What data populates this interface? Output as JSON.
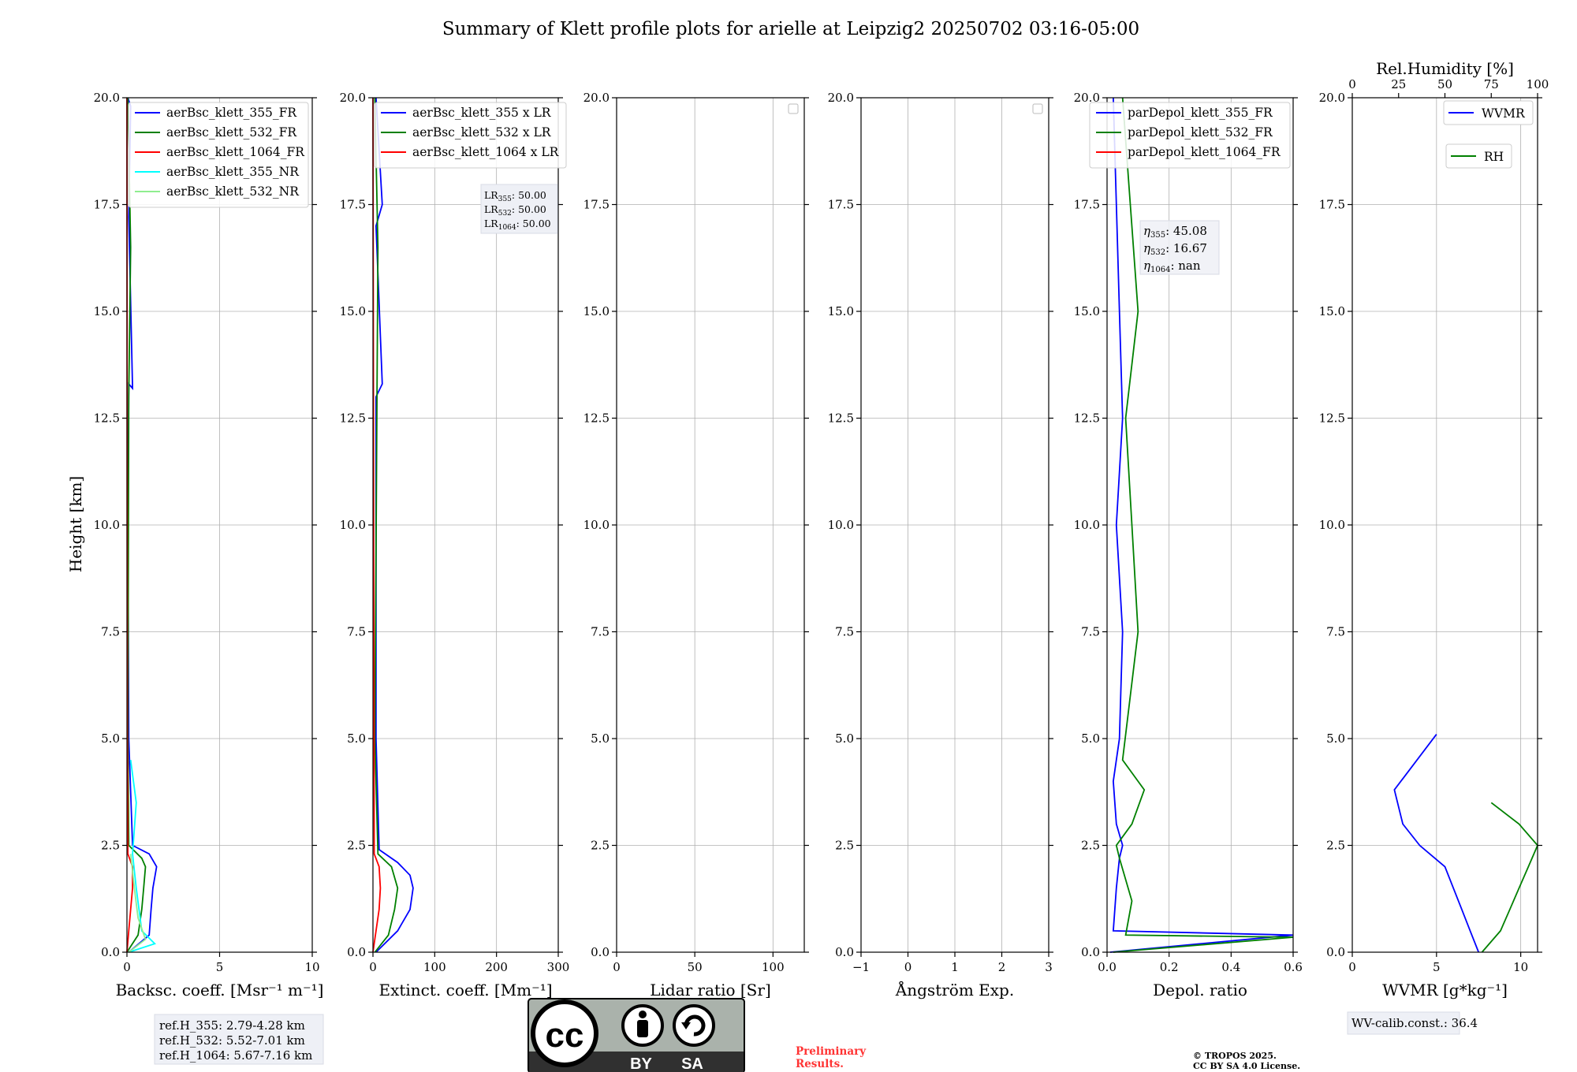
{
  "title": "Summary of Klett profile plots for arielle at Leipzig2 20250702 03:16-05:00",
  "y_axis_label": "Height [km]",
  "y_ticks": [
    "0.0",
    "2.5",
    "5.0",
    "7.5",
    "10.0",
    "12.5",
    "15.0",
    "17.5",
    "20.0"
  ],
  "colors": {
    "blue": "#0000ff",
    "green": "#008000",
    "red": "#ff0000",
    "cyan": "#00ffff",
    "lightgreen": "#90ee90",
    "preliminary": "#ff3333"
  },
  "refbox": [
    "ref.H_355: 2.79-4.28 km",
    "ref.H_532: 5.52-7.01 km",
    "ref.H_1064: 5.67-7.16 km"
  ],
  "lr_box": [
    "LR355: 50.00",
    "LR532: 50.00",
    "LR1064: 50.00"
  ],
  "eta_box": [
    "η355: 45.08",
    "η532: 16.67",
    "η1064: nan"
  ],
  "wv_calib": "WV-calib.const.: 36.4",
  "preliminary": [
    "Preliminary",
    "Results."
  ],
  "copyright": [
    "© TROPOS 2025.",
    "CC BY SA 4.0 License."
  ],
  "cc_logo": {
    "text": "cc",
    "by": "BY",
    "sa": "SA"
  },
  "chart_data": [
    {
      "type": "line",
      "xlabel": "Backsc. coeff. [Msr⁻¹ m⁻¹]",
      "ylabel": "Height [km]",
      "xlim": [
        0,
        10
      ],
      "ylim": [
        0,
        20
      ],
      "xticks": [
        "0",
        "5",
        "10"
      ],
      "legend": [
        "aerBsc_klett_355_FR",
        "aerBsc_klett_532_FR",
        "aerBsc_klett_1064_FR",
        "aerBsc_klett_355_NR",
        "aerBsc_klett_532_NR"
      ],
      "series": [
        {
          "name": "aerBsc_klett_355_FR",
          "color": "#0000ff",
          "x": [
            0.1,
            1.2,
            1.3,
            1.4,
            1.6,
            1.2,
            0.3,
            0.1,
            0.05,
            0.1,
            0.3,
            0.1,
            0.2,
            0.05
          ],
          "y": [
            0.0,
            0.4,
            1.0,
            1.5,
            2.0,
            2.3,
            2.5,
            5.0,
            10.0,
            13.3,
            13.2,
            17.2,
            19.8,
            20.0
          ]
        },
        {
          "name": "aerBsc_klett_532_FR",
          "color": "#008000",
          "x": [
            0.0,
            0.6,
            0.8,
            0.9,
            1.0,
            0.8,
            0.1,
            0.05,
            0.1,
            0.2,
            0.05
          ],
          "y": [
            0.0,
            0.4,
            1.0,
            1.5,
            2.0,
            2.2,
            2.5,
            5.0,
            13.0,
            16.5,
            20.0
          ]
        },
        {
          "name": "aerBsc_klett_1064_FR",
          "color": "#ff0000",
          "x": [
            0.0,
            0.1,
            0.2,
            0.3,
            0.3,
            0.05,
            0.02,
            0.0
          ],
          "y": [
            0.0,
            0.5,
            1.0,
            1.5,
            2.0,
            2.3,
            5.0,
            20.0
          ]
        },
        {
          "name": "aerBsc_klett_355_NR",
          "color": "#00ffff",
          "x": [
            0.1,
            1.5,
            0.8,
            0.5,
            0.3,
            0.5,
            0.2
          ],
          "y": [
            0.0,
            0.2,
            0.5,
            1.5,
            2.3,
            3.5,
            4.5
          ]
        },
        {
          "name": "aerBsc_klett_532_NR",
          "color": "#90ee90",
          "x": [
            0.1,
            1.0,
            0.6,
            0.4,
            0.2
          ],
          "y": [
            0.0,
            0.3,
            0.8,
            1.5,
            2.3
          ]
        }
      ]
    },
    {
      "type": "line",
      "xlabel": "Extinct. coeff. [Mm⁻¹]",
      "xlim": [
        0,
        300
      ],
      "ylim": [
        0,
        20
      ],
      "xticks": [
        "0",
        "100",
        "200",
        "300"
      ],
      "legend": [
        "aerBsc_klett_355 x LR",
        "aerBsc_klett_532 x LR",
        "aerBsc_klett_1064 x LR"
      ],
      "series": [
        {
          "name": "aerBsc_klett_355 x LR",
          "color": "#0000ff",
          "x": [
            5,
            40,
            60,
            65,
            60,
            40,
            10,
            5,
            5,
            15,
            5,
            15,
            5
          ],
          "y": [
            0.0,
            0.5,
            1.0,
            1.5,
            1.8,
            2.1,
            2.4,
            5.0,
            13.0,
            13.3,
            17.0,
            17.5,
            20.0
          ]
        },
        {
          "name": "aerBsc_klett_532 x LR",
          "color": "#008000",
          "x": [
            3,
            25,
            35,
            40,
            30,
            8,
            3,
            8,
            3
          ],
          "y": [
            0.0,
            0.4,
            1.0,
            1.5,
            2.0,
            2.3,
            5.0,
            16.5,
            20.0
          ]
        },
        {
          "name": "aerBsc_klett_1064 x LR",
          "color": "#ff0000",
          "x": [
            0,
            5,
            10,
            12,
            10,
            2,
            0
          ],
          "y": [
            0.0,
            0.5,
            1.0,
            1.5,
            2.0,
            2.3,
            20.0
          ]
        }
      ]
    },
    {
      "type": "line",
      "xlabel": "Lidar ratio [Sr]",
      "xlim": [
        0,
        120
      ],
      "ylim": [
        0,
        20
      ],
      "xticks": [
        "0",
        "50",
        "100"
      ],
      "series": []
    },
    {
      "type": "line",
      "xlabel": "Ångström Exp.",
      "xlim": [
        -1,
        3
      ],
      "ylim": [
        0,
        20
      ],
      "xticks": [
        "−1",
        "0",
        "1",
        "2",
        "3"
      ],
      "series": []
    },
    {
      "type": "line",
      "xlabel": "Depol. ratio",
      "xlim": [
        0,
        0.6
      ],
      "ylim": [
        0,
        20
      ],
      "xticks": [
        "0.0",
        "0.2",
        "0.4",
        "0.6"
      ],
      "legend": [
        "parDepol_klett_355_FR",
        "parDepol_klett_532_FR",
        "parDepol_klett_1064_FR"
      ],
      "series": [
        {
          "name": "parDepol_klett_355_FR",
          "color": "#0000ff",
          "x": [
            0.01,
            0.6,
            0.02,
            0.03,
            0.04,
            0.05,
            0.03,
            0.02,
            0.04,
            0.05,
            0.03,
            0.05,
            0.04,
            0.03,
            0.02
          ],
          "y": [
            0.0,
            0.4,
            0.5,
            1.5,
            2.2,
            2.5,
            3.0,
            4.0,
            5.0,
            7.5,
            10.0,
            12.5,
            15.0,
            17.5,
            20.0
          ]
        },
        {
          "name": "parDepol_klett_532_FR",
          "color": "#008000",
          "x": [
            0.02,
            0.6,
            0.06,
            0.08,
            0.04,
            0.03,
            0.08,
            0.12,
            0.05,
            0.1,
            0.08,
            0.06,
            0.1,
            0.05
          ],
          "y": [
            0.0,
            0.35,
            0.4,
            1.2,
            2.2,
            2.5,
            3.0,
            3.8,
            4.5,
            7.5,
            10.0,
            12.5,
            15.0,
            20.0
          ]
        },
        {
          "name": "parDepol_klett_1064_FR",
          "color": "#ff0000",
          "x": [],
          "y": []
        }
      ]
    },
    {
      "type": "line",
      "xlabel": "WVMR [g*kg⁻¹]",
      "x2label": "Rel.Humidity [%]",
      "xlim": [
        0,
        11
      ],
      "x2lim": [
        0,
        100
      ],
      "ylim": [
        0,
        20
      ],
      "xticks": [
        "0",
        "5",
        "10"
      ],
      "x2ticks": [
        "0",
        "25",
        "50",
        "75",
        "100"
      ],
      "legend": [
        "WVMR",
        "RH"
      ],
      "series": [
        {
          "name": "WVMR",
          "color": "#0000ff",
          "x": [
            7.5,
            7.0,
            6.5,
            6.0,
            5.5,
            4.0,
            3.0,
            2.5,
            5.0
          ],
          "y": [
            0.0,
            0.5,
            1.0,
            1.5,
            2.0,
            2.5,
            3.0,
            3.8,
            5.1
          ]
        },
        {
          "name": "RH",
          "color": "#008000",
          "x2": [
            70,
            80,
            85,
            90,
            95,
            100,
            90,
            75
          ],
          "y": [
            0.0,
            0.5,
            1.0,
            1.5,
            2.0,
            2.5,
            3.0,
            3.5
          ]
        }
      ]
    }
  ]
}
